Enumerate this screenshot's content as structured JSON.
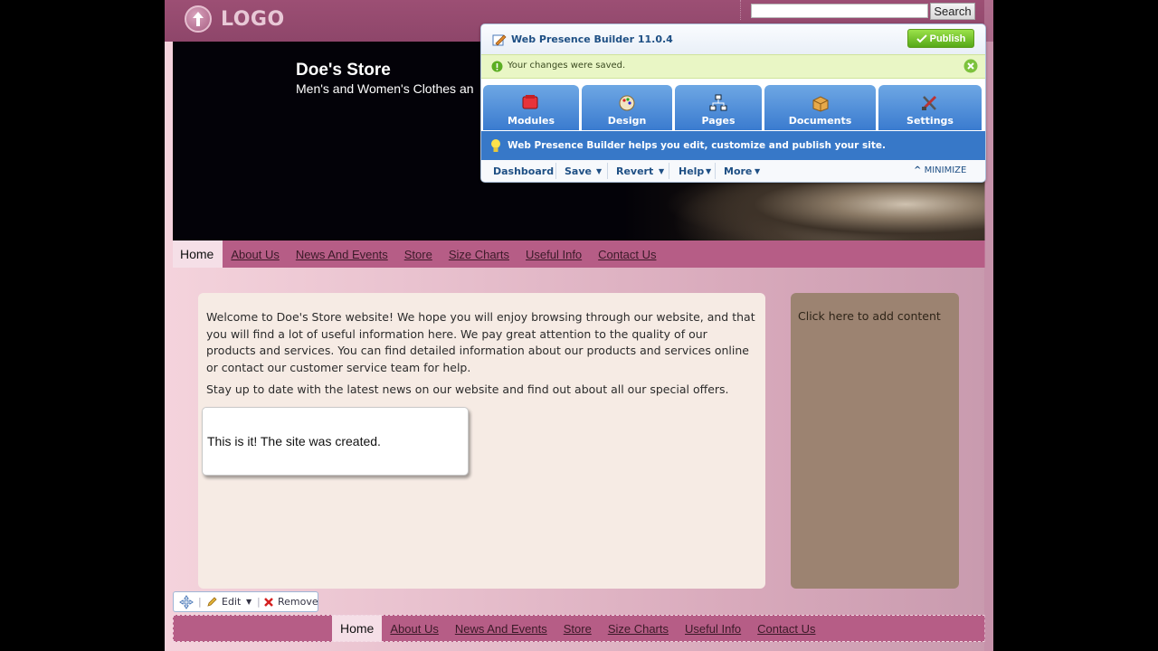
{
  "header": {
    "logo_text": "LOGO",
    "search_placeholder": "",
    "search_button": "Search"
  },
  "hero": {
    "title": "Doe's Store",
    "subtitle": "Men's and Women's Clothes an"
  },
  "nav": {
    "items": [
      "Home",
      "About Us",
      "News And Events",
      "Store",
      "Size Charts",
      "Useful Info",
      "Contact Us"
    ],
    "active": "Home"
  },
  "content": {
    "para1": "Welcome to Doe's Store website! We hope you will enjoy browsing through our website, and that you will find a lot of useful information here. We pay great attention to the quality of our products and services. You can find detailed information about our products and services online or contact our customer service team for help.",
    "para2": "Stay up to date with the latest news on our website and find out about all our special offers.",
    "callout": "This is it! The site was created."
  },
  "sidebar": {
    "placeholder": "Click here to add content"
  },
  "edit_toolbar": {
    "edit": "Edit",
    "remove": "Remove"
  },
  "builder": {
    "title": "Web Presence Builder 11.0.4",
    "publish": "Publish",
    "notice": "Your changes were saved.",
    "tabs": [
      "Modules",
      "Design",
      "Pages",
      "Documents",
      "Settings"
    ],
    "info": "Web Presence Builder helps you edit, customize and publish your site.",
    "menu": [
      "Dashboard",
      "Save",
      "Revert",
      "Help",
      "More"
    ],
    "minimize": "MINIMIZE"
  },
  "colors": {
    "nav_bg": "#b65d86",
    "builder_blue": "#3778c8",
    "publish_green": "#56a817"
  }
}
